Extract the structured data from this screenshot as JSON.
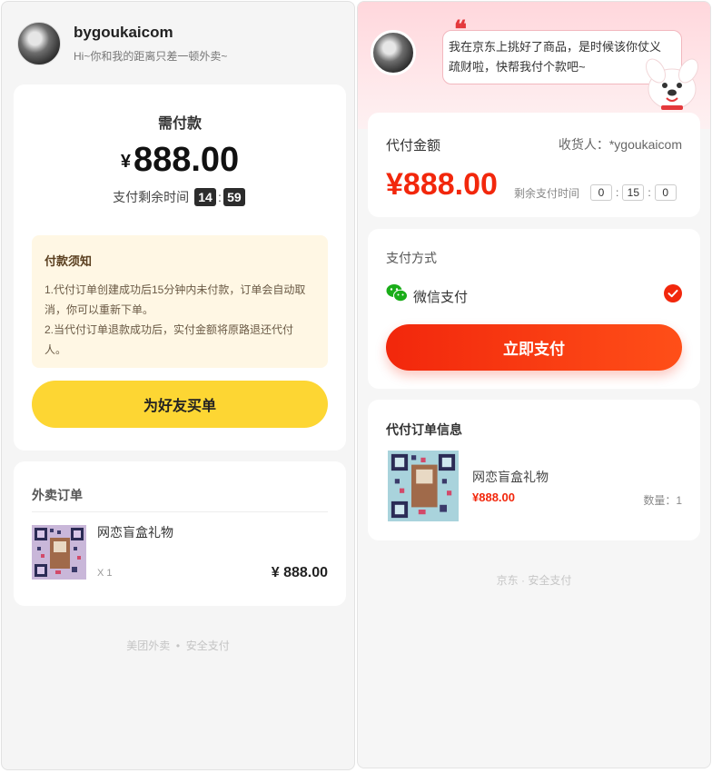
{
  "meituan": {
    "header": {
      "username": "bygoukaicom",
      "greeting": "Hi~你和我的距离只差一顿外卖~"
    },
    "payment": {
      "title": "需付款",
      "currency": "¥",
      "amount": "888.00",
      "timer_label": "支付剩余时间",
      "timer_minutes": "14",
      "timer_separator": ":",
      "timer_seconds": "59"
    },
    "notice": {
      "title": "付款须知",
      "lines": [
        "1.代付订单创建成功后15分钟内未付款，订单会自动取",
        "消，你可以重新下单。",
        "2.当代付订单退款成功后，实付金额将原路退还代付",
        "人。"
      ]
    },
    "buy_button_label": "为好友买单",
    "order": {
      "title": "外卖订单",
      "item_name": "网恋盲盒礼物",
      "item_qty": "X 1",
      "item_price": "¥ 888.00"
    },
    "footer": {
      "left": "美团外卖",
      "dot": "•",
      "right": "安全支付"
    }
  },
  "jd": {
    "bubble_text_line1": "我在京东上挑好了商品，是时候该你仗义",
    "bubble_text_line2": "疏财啦，快帮我付个款吧~",
    "amount_card": {
      "label": "代付金额",
      "receiver": "收货人：*ygoukaicom",
      "amount": "¥888.00",
      "remaining_label": "剩余支付时间",
      "hours": "0",
      "minutes": "15",
      "seconds": "0",
      "separator": ":"
    },
    "method_card": {
      "title": "支付方式",
      "wechat_label": "微信支付",
      "pay_button_label": "立即支付"
    },
    "order_card": {
      "title": "代付订单信息",
      "item_name": "网恋盲盒礼物",
      "item_price": "¥888.00",
      "item_qty": "数量：1"
    },
    "footer": "京东 · 安全支付"
  },
  "colors": {
    "meituan_yellow": "#fdd633",
    "jd_red": "#f2270c",
    "wechat_green": "#1aad19"
  },
  "icons": [
    "avatar",
    "quote-icon",
    "jd-mascot-icon",
    "wechat-icon",
    "check-icon",
    "qr-thumbnail"
  ]
}
